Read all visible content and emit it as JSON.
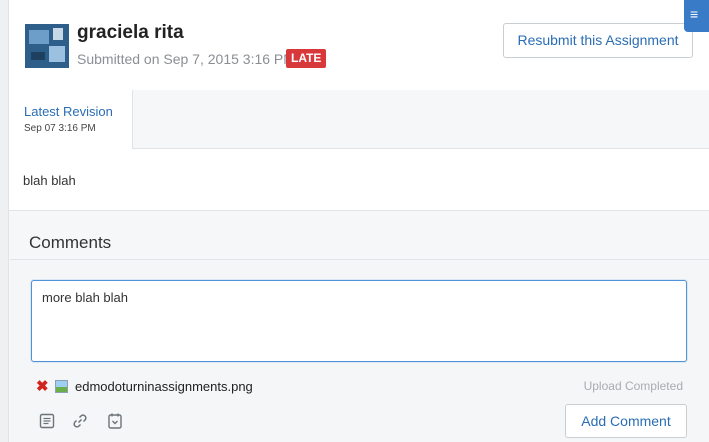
{
  "submission": {
    "student_name": "graciela rita",
    "submitted_text": "Submitted on Sep 7, 2015 3:16 PM",
    "late_badge": "LATE",
    "resubmit_label": "Resubmit this Assignment"
  },
  "revision_tab": {
    "title": "Latest Revision",
    "date": "Sep 07 3:16 PM"
  },
  "submission_body": "blah blah",
  "comments": {
    "heading": "Comments",
    "input_value": "more blah blah",
    "attachment": {
      "file_name": "edmodoturninassignments.png",
      "status": "Upload Completed"
    },
    "add_comment_label": "Add Comment",
    "tool_icons": [
      "document-icon",
      "link-icon",
      "library-icon"
    ]
  },
  "colors": {
    "accent_blue": "#2a6db5",
    "late_red": "#d9383a",
    "remove_red": "#d2241f",
    "input_border": "#4f93d8"
  }
}
